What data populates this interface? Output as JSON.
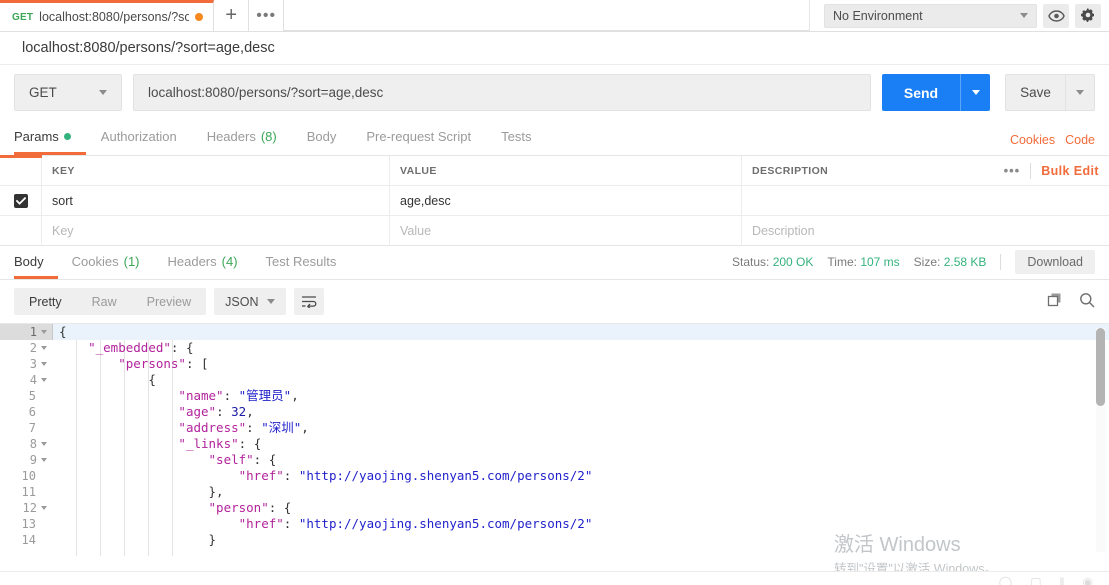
{
  "tabstrip": {
    "active_tab": {
      "method": "GET",
      "title": "localhost:8080/persons/?sort=ag",
      "unsaved": "●"
    },
    "new_tab_label": "+",
    "more_label": "•••"
  },
  "environment": {
    "selected": "No Environment",
    "eye_title": "Environment quick look",
    "gear_title": "Settings"
  },
  "breadcrumb": "localhost:8080/persons/?sort=age,desc",
  "request": {
    "method": "GET",
    "url": "localhost:8080/persons/?sort=age,desc",
    "send_label": "Send",
    "save_label": "Save"
  },
  "request_tabs": [
    {
      "label": "Params",
      "active": true,
      "dot": true
    },
    {
      "label": "Authorization",
      "active": false
    },
    {
      "label": "Headers",
      "count": "(8)",
      "active": false
    },
    {
      "label": "Body",
      "active": false
    },
    {
      "label": "Pre-request Script",
      "active": false
    },
    {
      "label": "Tests",
      "active": false
    }
  ],
  "request_tabs_right": {
    "cookies": "Cookies",
    "code": "Code"
  },
  "params_table": {
    "headers": {
      "key": "KEY",
      "value": "VALUE",
      "description": "DESCRIPTION"
    },
    "bulk_edit": "Bulk Edit",
    "dots": "•••",
    "rows": [
      {
        "checked": true,
        "key": "sort",
        "value": "age,desc",
        "description": ""
      }
    ],
    "placeholders": {
      "key": "Key",
      "value": "Value",
      "description": "Description"
    }
  },
  "response_tabs": [
    {
      "label": "Body",
      "active": true
    },
    {
      "label": "Cookies",
      "count": "(1)",
      "active": false
    },
    {
      "label": "Headers",
      "count": "(4)",
      "active": false
    },
    {
      "label": "Test Results",
      "active": false
    }
  ],
  "response_meta": {
    "status_label": "Status:",
    "status_value": "200 OK",
    "time_label": "Time:",
    "time_value": "107 ms",
    "size_label": "Size:",
    "size_value": "2.58 KB",
    "download_label": "Download"
  },
  "body_toolbar": {
    "modes": [
      {
        "label": "Pretty",
        "active": true
      },
      {
        "label": "Raw",
        "active": false
      },
      {
        "label": "Preview",
        "active": false
      }
    ],
    "format": "JSON",
    "wrap_title": "Wrap line"
  },
  "editor": {
    "lines": [
      {
        "num": "1",
        "fold": true,
        "active": true,
        "indent": 0,
        "tokens": [
          {
            "t": "p",
            "v": "{"
          }
        ]
      },
      {
        "num": "2",
        "fold": true,
        "active": false,
        "indent": 1,
        "tokens": [
          {
            "t": "k",
            "v": "\"_embedded\""
          },
          {
            "t": "p",
            "v": ": {"
          }
        ]
      },
      {
        "num": "3",
        "fold": true,
        "active": false,
        "indent": 2,
        "tokens": [
          {
            "t": "k",
            "v": "\"persons\""
          },
          {
            "t": "p",
            "v": ": ["
          }
        ]
      },
      {
        "num": "4",
        "fold": true,
        "active": false,
        "indent": 3,
        "tokens": [
          {
            "t": "p",
            "v": "{"
          }
        ]
      },
      {
        "num": "5",
        "fold": false,
        "active": false,
        "indent": 4,
        "tokens": [
          {
            "t": "k",
            "v": "\"name\""
          },
          {
            "t": "p",
            "v": ": "
          },
          {
            "t": "s",
            "v": "\"管理员\""
          },
          {
            "t": "p",
            "v": ","
          }
        ]
      },
      {
        "num": "6",
        "fold": false,
        "active": false,
        "indent": 4,
        "tokens": [
          {
            "t": "k",
            "v": "\"age\""
          },
          {
            "t": "p",
            "v": ": "
          },
          {
            "t": "n",
            "v": "32"
          },
          {
            "t": "p",
            "v": ","
          }
        ]
      },
      {
        "num": "7",
        "fold": false,
        "active": false,
        "indent": 4,
        "tokens": [
          {
            "t": "k",
            "v": "\"address\""
          },
          {
            "t": "p",
            "v": ": "
          },
          {
            "t": "s",
            "v": "\"深圳\""
          },
          {
            "t": "p",
            "v": ","
          }
        ]
      },
      {
        "num": "8",
        "fold": true,
        "active": false,
        "indent": 4,
        "tokens": [
          {
            "t": "k",
            "v": "\"_links\""
          },
          {
            "t": "p",
            "v": ": {"
          }
        ]
      },
      {
        "num": "9",
        "fold": true,
        "active": false,
        "indent": 5,
        "tokens": [
          {
            "t": "k",
            "v": "\"self\""
          },
          {
            "t": "p",
            "v": ": {"
          }
        ]
      },
      {
        "num": "10",
        "fold": false,
        "active": false,
        "indent": 6,
        "tokens": [
          {
            "t": "k",
            "v": "\"href\""
          },
          {
            "t": "p",
            "v": ": "
          },
          {
            "t": "s",
            "v": "\"http://yaojing.shenyan5.com/persons/2\""
          }
        ]
      },
      {
        "num": "11",
        "fold": false,
        "active": false,
        "indent": 5,
        "tokens": [
          {
            "t": "p",
            "v": "},"
          }
        ]
      },
      {
        "num": "12",
        "fold": true,
        "active": false,
        "indent": 5,
        "tokens": [
          {
            "t": "k",
            "v": "\"person\""
          },
          {
            "t": "p",
            "v": ": {"
          }
        ]
      },
      {
        "num": "13",
        "fold": false,
        "active": false,
        "indent": 6,
        "tokens": [
          {
            "t": "k",
            "v": "\"href\""
          },
          {
            "t": "p",
            "v": ": "
          },
          {
            "t": "s",
            "v": "\"http://yaojing.shenyan5.com/persons/2\""
          }
        ]
      },
      {
        "num": "14",
        "fold": false,
        "active": false,
        "indent": 5,
        "tokens": [
          {
            "t": "p",
            "v": "}"
          }
        ]
      }
    ]
  },
  "watermark": {
    "line1": "激活 Windows",
    "line2": "转到\"设置\"以激活 Windows。"
  },
  "colors": {
    "accent_orange": "#f26b3a",
    "send_blue": "#1a7ff4",
    "status_green": "#34b27d",
    "method_green": "#3aa757"
  }
}
